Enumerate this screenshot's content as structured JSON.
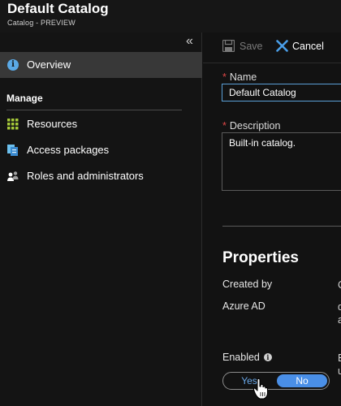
{
  "header": {
    "title": "Default Catalog",
    "subtitle": "Catalog - PREVIEW"
  },
  "sidebar": {
    "collapse_glyph": "«",
    "overview": {
      "label": "Overview",
      "icon": "info-icon"
    },
    "manage_heading": "Manage",
    "items": [
      {
        "label": "Resources",
        "icon": "grid-icon"
      },
      {
        "label": "Access packages",
        "icon": "pages-icon"
      },
      {
        "label": "Roles and administrators",
        "icon": "people-icon"
      }
    ]
  },
  "toolbar": {
    "save_label": "Save",
    "cancel_label": "Cancel"
  },
  "form": {
    "required_marker": "*",
    "name_label": "Name",
    "name_value": "Default Catalog",
    "description_label": "Description",
    "description_value": "Built-in catalog."
  },
  "properties": {
    "heading": "Properties",
    "created_by_label": "Created by",
    "created_by_value": "C",
    "source_label": "Azure AD",
    "source_value_1": "d",
    "source_value_2": "a",
    "enabled_label": "Enabled",
    "enabled_value_1": "E",
    "enabled_value_2": "u",
    "toggle": {
      "yes_label": "Yes",
      "no_label": "No",
      "selected": "No"
    }
  },
  "colors": {
    "background": "#121212",
    "accent": "#4a8fe7",
    "info_blue": "#5aa9e6",
    "required_red": "#e04848",
    "selected_nav": "#383838"
  }
}
